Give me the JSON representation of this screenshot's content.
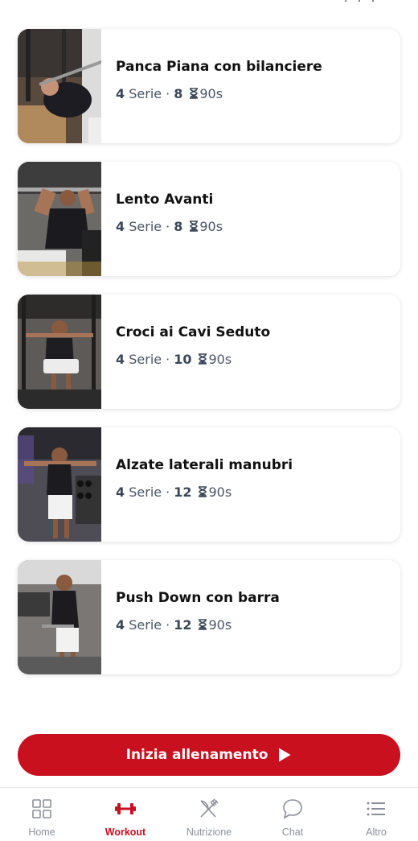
{
  "exercises": [
    {
      "name": "Panca Piana con bilanciere",
      "sets": "4",
      "sets_label": "Serie",
      "reps": "8",
      "rest": "90s",
      "thumbnail": "bench-press-photo"
    },
    {
      "name": "Lento Avanti",
      "sets": "4",
      "sets_label": "Serie",
      "reps": "8",
      "rest": "90s",
      "thumbnail": "shoulder-press-photo"
    },
    {
      "name": "Croci ai Cavi Seduto",
      "sets": "4",
      "sets_label": "Serie",
      "reps": "10",
      "rest": "90s",
      "thumbnail": "cable-fly-photo"
    },
    {
      "name": "Alzate laterali manubri",
      "sets": "4",
      "sets_label": "Serie",
      "reps": "12",
      "rest": "90s",
      "thumbnail": "lateral-raise-photo"
    },
    {
      "name": "Push Down con barra",
      "sets": "4",
      "sets_label": "Serie",
      "reps": "12",
      "rest": "90s",
      "thumbnail": "push-down-photo"
    }
  ],
  "cta": {
    "label": "Inizia allenamento",
    "icon": "play-icon"
  },
  "tabbar": [
    {
      "label": "Home",
      "icon": "grid-icon",
      "active": false
    },
    {
      "label": "Workout",
      "icon": "dumbbell-icon",
      "active": true
    },
    {
      "label": "Nutrizione",
      "icon": "fork-knife-icon",
      "active": false
    },
    {
      "label": "Chat",
      "icon": "chat-bubble-icon",
      "active": false
    },
    {
      "label": "Altro",
      "icon": "list-icon",
      "active": false
    }
  ],
  "colors": {
    "accent": "#c8101f",
    "meta_text": "#4a5568",
    "inactive_tab": "#8a8f99"
  }
}
